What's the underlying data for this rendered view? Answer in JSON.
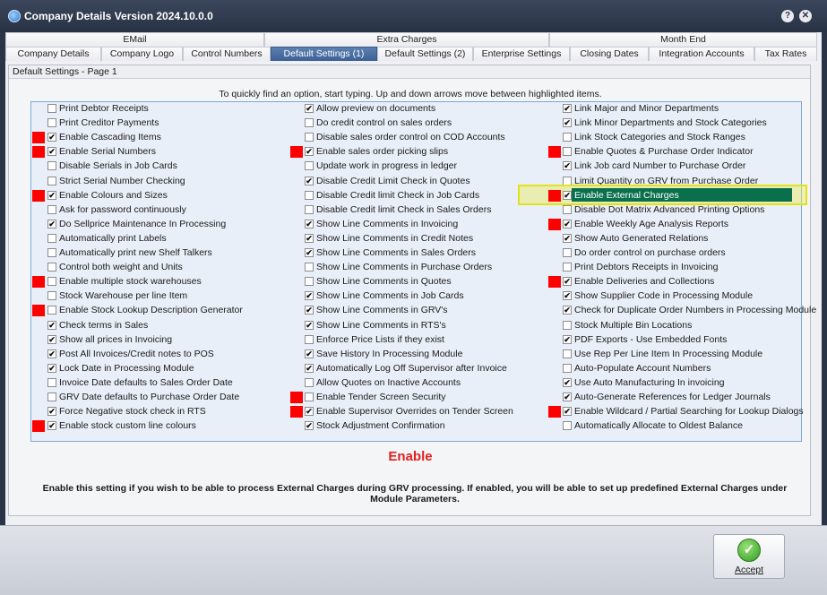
{
  "window": {
    "title": "Company Details Version 2024.10.0.0",
    "help_glyph": "?",
    "close_glyph": "✕"
  },
  "tabs_row1": [
    "EMail",
    "Extra Charges",
    "Month End"
  ],
  "tabs_row2": [
    "Company Details",
    "Company Logo",
    "Control Numbers",
    "Default Settings (1)",
    "Default Settings (2)",
    "Enterprise Settings",
    "Closing Dates",
    "Integration Accounts",
    "Tax Rates"
  ],
  "active_tab": "Default Settings (1)",
  "page": {
    "label": "Default Settings - Page 1",
    "hint": "To quickly find an option, start typing. Up and down arrows move between highlighted items."
  },
  "columns": [
    {
      "items": [
        {
          "label": "Print Debtor Receipts",
          "checked": false,
          "flag": false
        },
        {
          "label": "Print Creditor Payments",
          "checked": false,
          "flag": false
        },
        {
          "label": "Enable Cascading Items",
          "checked": true,
          "flag": true
        },
        {
          "label": "Enable Serial Numbers",
          "checked": true,
          "flag": true
        },
        {
          "label": "Disable Serials in Job Cards",
          "checked": false,
          "flag": false
        },
        {
          "label": "Strict Serial Number Checking",
          "checked": false,
          "flag": false
        },
        {
          "label": "Enable Colours and Sizes",
          "checked": true,
          "flag": true
        },
        {
          "label": "Ask for password continuously",
          "checked": false,
          "flag": false
        },
        {
          "label": "Do Sellprice Maintenance In Processing",
          "checked": true,
          "flag": false
        },
        {
          "label": "Automatically print Labels",
          "checked": false,
          "flag": false
        },
        {
          "label": "Automatically print new Shelf Talkers",
          "checked": false,
          "flag": false
        },
        {
          "label": "Control both weight and Units",
          "checked": false,
          "flag": false
        },
        {
          "label": "Enable multiple stock warehouses",
          "checked": false,
          "flag": true
        },
        {
          "label": "Stock Warehouse per line Item",
          "checked": false,
          "flag": false
        },
        {
          "label": "Enable Stock Lookup Description Generator",
          "checked": false,
          "flag": true
        },
        {
          "label": "Check terms in Sales",
          "checked": true,
          "flag": false
        },
        {
          "label": "Show all prices in Invoicing",
          "checked": true,
          "flag": false
        },
        {
          "label": "Post All Invoices/Credit notes to POS",
          "checked": true,
          "flag": false
        },
        {
          "label": "Lock Date in Processing Module",
          "checked": true,
          "flag": false
        },
        {
          "label": "Invoice Date defaults to Sales Order Date",
          "checked": false,
          "flag": false
        },
        {
          "label": "GRV Date defaults to Purchase Order Date",
          "checked": false,
          "flag": false
        },
        {
          "label": "Force Negative stock check in RTS",
          "checked": true,
          "flag": false
        },
        {
          "label": "Enable stock custom line colours",
          "checked": true,
          "flag": true
        }
      ]
    },
    {
      "items": [
        {
          "label": "Allow preview on documents",
          "checked": true,
          "flag": false
        },
        {
          "label": "Do credit control on sales orders",
          "checked": false,
          "flag": false
        },
        {
          "label": "Disable sales order control on COD Accounts",
          "checked": false,
          "flag": false
        },
        {
          "label": "Enable sales order picking slips",
          "checked": true,
          "flag": true
        },
        {
          "label": "Update work in progress in ledger",
          "checked": false,
          "flag": false
        },
        {
          "label": "Disable Credit Limit Check in Quotes",
          "checked": true,
          "flag": false
        },
        {
          "label": "Disable Credit limit Check in Job Cards",
          "checked": false,
          "flag": false
        },
        {
          "label": "Disable Credit limit Check in Sales Orders",
          "checked": false,
          "flag": false
        },
        {
          "label": "Show Line Comments in Invoicing",
          "checked": true,
          "flag": false
        },
        {
          "label": "Show Line Comments in Credit Notes",
          "checked": true,
          "flag": false
        },
        {
          "label": "Show Line Comments in Sales Orders",
          "checked": true,
          "flag": false
        },
        {
          "label": "Show Line Comments in Purchase Orders",
          "checked": false,
          "flag": false
        },
        {
          "label": "Show Line Comments in Quotes",
          "checked": false,
          "flag": false
        },
        {
          "label": "Show Line Comments in Job Cards",
          "checked": true,
          "flag": false
        },
        {
          "label": "Show Line Comments in GRV's",
          "checked": true,
          "flag": false
        },
        {
          "label": "Show Line Comments in RTS's",
          "checked": true,
          "flag": false
        },
        {
          "label": "Enforce Price Lists if they exist",
          "checked": false,
          "flag": false
        },
        {
          "label": "Save History In Processing Module",
          "checked": true,
          "flag": false
        },
        {
          "label": "Automatically Log Off Supervisor after Invoice",
          "checked": true,
          "flag": false
        },
        {
          "label": "Allow Quotes on Inactive Accounts",
          "checked": false,
          "flag": false
        },
        {
          "label": "Enable Tender Screen Security",
          "checked": false,
          "flag": true
        },
        {
          "label": "Enable Supervisor Overrides on Tender Screen",
          "checked": true,
          "flag": true
        },
        {
          "label": "Stock Adjustment Confirmation",
          "checked": true,
          "flag": false
        }
      ]
    },
    {
      "items": [
        {
          "label": "Link Major and Minor Departments",
          "checked": true,
          "flag": false
        },
        {
          "label": "Link Minor Departments and Stock Categories",
          "checked": true,
          "flag": false
        },
        {
          "label": "Link Stock Categories and Stock Ranges",
          "checked": false,
          "flag": false
        },
        {
          "label": "Enable Quotes & Purchase Order Indicator",
          "checked": false,
          "flag": true
        },
        {
          "label": "Link Job card Number to Purchase Order",
          "checked": true,
          "flag": false
        },
        {
          "label": "Limit Quantity on GRV from Purchase Order",
          "checked": false,
          "flag": false
        },
        {
          "label": "Enable External Charges",
          "checked": true,
          "flag": true,
          "highlight": true
        },
        {
          "label": "Disable Dot Matrix Advanced Printing Options",
          "checked": false,
          "flag": false
        },
        {
          "label": "Enable Weekly Age Analysis Reports",
          "checked": true,
          "flag": true
        },
        {
          "label": "Show Auto Generated Relations",
          "checked": true,
          "flag": false
        },
        {
          "label": "Do order control on purchase orders",
          "checked": false,
          "flag": false
        },
        {
          "label": "Print Debtors Receipts in Invoicing",
          "checked": false,
          "flag": false
        },
        {
          "label": "Enable Deliveries and Collections",
          "checked": true,
          "flag": true
        },
        {
          "label": "Show Supplier Code in Processing Module",
          "checked": true,
          "flag": false
        },
        {
          "label": "Check for Duplicate Order Numbers in Processing Module",
          "checked": true,
          "flag": false
        },
        {
          "label": "Stock Multiple Bin Locations",
          "checked": false,
          "flag": false
        },
        {
          "label": "PDF Exports - Use Embedded Fonts",
          "checked": true,
          "flag": false
        },
        {
          "label": "Use Rep Per Line Item In Processing Module",
          "checked": false,
          "flag": false
        },
        {
          "label": "Auto-Populate Account Numbers",
          "checked": false,
          "flag": false
        },
        {
          "label": "Use Auto Manufacturing In invoicing",
          "checked": true,
          "flag": false
        },
        {
          "label": "Auto-Generate References for Ledger Journals",
          "checked": true,
          "flag": false
        },
        {
          "label": "Enable Wildcard / Partial Searching for Lookup Dialogs",
          "checked": true,
          "flag": true
        },
        {
          "label": "Automatically Allocate to Oldest Balance",
          "checked": false,
          "flag": false
        }
      ]
    }
  ],
  "selected": {
    "title": "Enable",
    "description": "Enable this setting if you wish to be able to process External Charges during GRV processing. If enabled, you will be able to set up predefined External Charges under Module Parameters."
  },
  "footer": {
    "accept_label": "Accept",
    "accept_glyph": "✓"
  },
  "colors": {
    "flag": "#ff0000",
    "highlight_bar": "#0a6f4c",
    "highlight_frame": "#e2e21c",
    "enable_title": "#e02020"
  }
}
